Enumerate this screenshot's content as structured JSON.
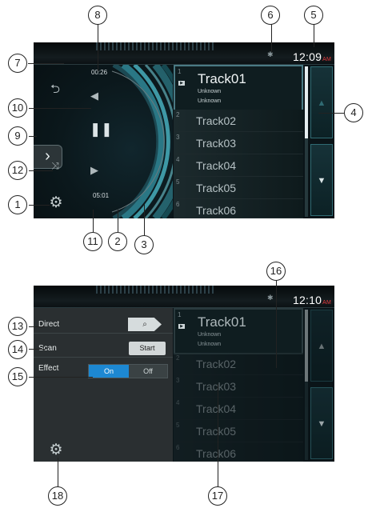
{
  "screen1": {
    "clock": {
      "time": "12:09",
      "ampm": "AM"
    },
    "elapsed": "00:26",
    "total": "05:01",
    "tracks": [
      {
        "n": "1",
        "title": "Track01",
        "sub1": "Unknown",
        "sub2": "Unknown"
      },
      {
        "n": "2",
        "title": "Track02"
      },
      {
        "n": "3",
        "title": "Track03"
      },
      {
        "n": "4",
        "title": "Track04"
      },
      {
        "n": "5",
        "title": "Track05"
      },
      {
        "n": "6",
        "title": "Track06"
      }
    ],
    "icons": {
      "repeat": "repeat-icon",
      "previous": "previous-track-icon",
      "pause": "pause-icon",
      "menu_arrow": "chevron-right-icon",
      "shuffle": "shuffle-icon",
      "next": "next-track-icon",
      "settings": "gear-icon",
      "bluetooth": "bluetooth-icon",
      "page_up": "up-triangle-icon",
      "page_down": "down-triangle-icon"
    }
  },
  "screen2": {
    "clock": {
      "time": "12:10",
      "ampm": "AM"
    },
    "settings": {
      "direct_label": "Direct",
      "scan_label": "Scan",
      "scan_button": "Start",
      "effect_label": "Effect",
      "effect_on": "On",
      "effect_off": "Off"
    },
    "tracks": [
      {
        "n": "1",
        "title": "Track01",
        "sub1": "Unknown",
        "sub2": "Unknown"
      },
      {
        "n": "2",
        "title": "Track02"
      },
      {
        "n": "3",
        "title": "Track03"
      },
      {
        "n": "4",
        "title": "Track04"
      },
      {
        "n": "5",
        "title": "Track05"
      },
      {
        "n": "6",
        "title": "Track06"
      }
    ]
  },
  "callouts": [
    "1",
    "2",
    "3",
    "4",
    "5",
    "6",
    "7",
    "8",
    "9",
    "10",
    "11",
    "12",
    "13",
    "14",
    "15",
    "16",
    "17",
    "18"
  ],
  "colors": {
    "accent": "#1d88d2",
    "ampm": "#e5393c",
    "teal": "#2f6a72"
  }
}
